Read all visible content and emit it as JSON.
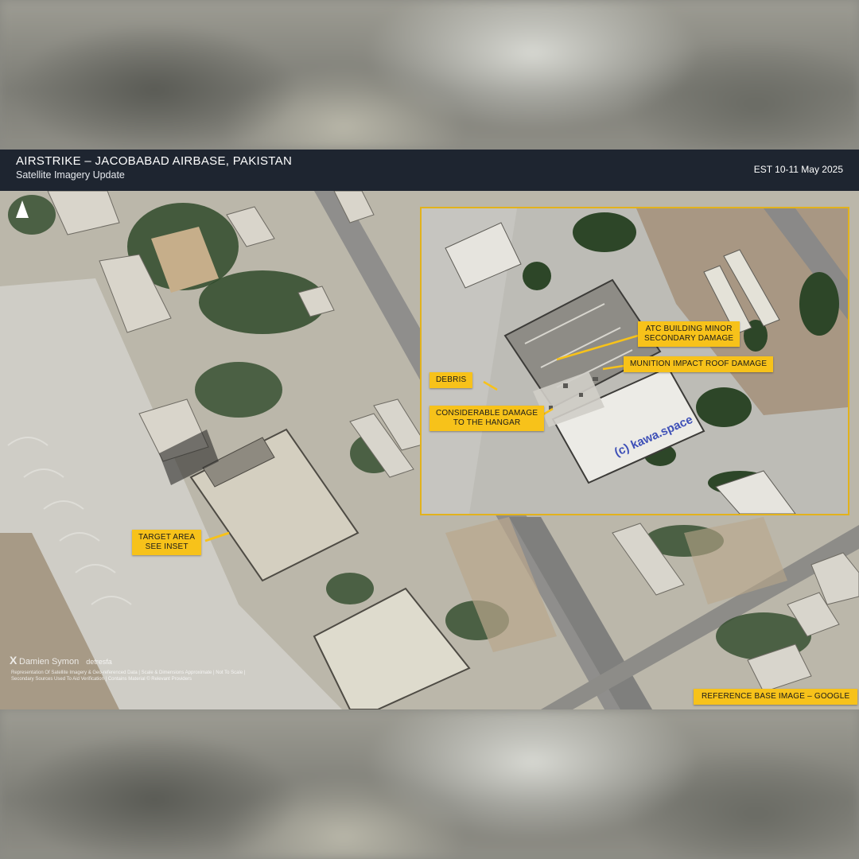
{
  "header": {
    "title": "AIRSTRIKE – JACOBABAD AIRBASE, PAKISTAN",
    "subtitle": "Satellite Imagery Update",
    "date": "EST 10-11 May 2025"
  },
  "labels": {
    "target_area": "TARGET AREA\nSEE INSET",
    "reference": "REFERENCE BASE IMAGE – GOOGLE"
  },
  "inset": {
    "atc": "ATC BUILDING MINOR\nSECONDARY DAMAGE",
    "munition": "MUNITION IMPACT ROOF DAMAGE",
    "debris": "DEBRIS",
    "hangar": "CONSIDERABLE DAMAGE\nTO THE HANGAR",
    "watermark": "(c) kawa.space"
  },
  "credits": {
    "x_logo": "X",
    "name": "Damien Symon",
    "handle": "detresfa",
    "fine_print": "Representation Of Satellite Imagery & Geo-referenced Data | Scale & Dimensions Approximate | Not To Scale | Secondary Sources Used To Aid Verification | Contains Material © Relevant Providers"
  },
  "icons": {
    "north_arrow": "north-arrow-icon"
  },
  "colors": {
    "header_bg": "#1e2530",
    "label_bg": "#f7c21a",
    "inset_border": "#e2b21c"
  }
}
